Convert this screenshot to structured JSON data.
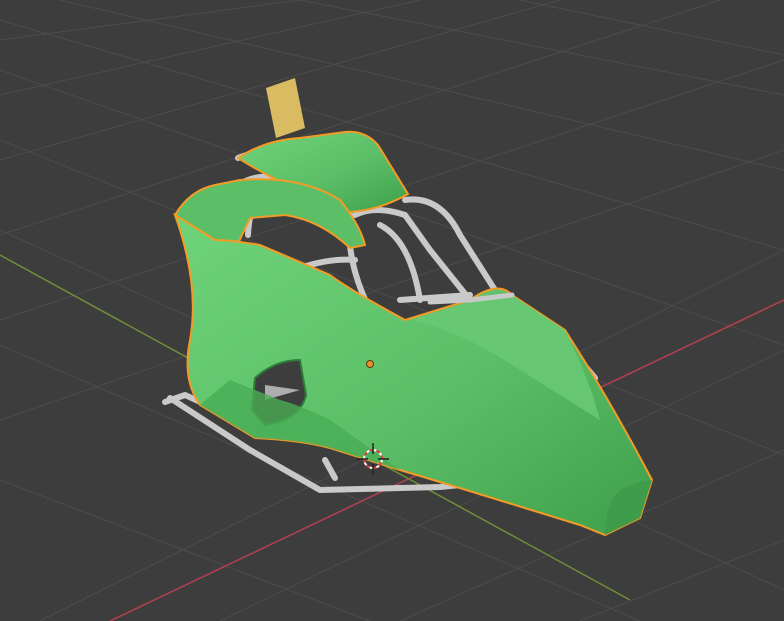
{
  "viewport": {
    "background": "#3d3d3d",
    "grid_color": "#4a4a4a",
    "x_axis_color": "#b5404f",
    "y_axis_color": "#6e8f3a"
  },
  "model": {
    "body_color": "#5cbf67",
    "body_shadow": "#3e9c4a",
    "outline_color": "#f39b26",
    "frame_color": "#c9c9c9",
    "frame_shadow": "#8a8a8a",
    "flag_color": "#d9bb62"
  },
  "overlay": {
    "origin_color": "#e8902b",
    "cursor_icon": "3d-cursor-icon"
  }
}
